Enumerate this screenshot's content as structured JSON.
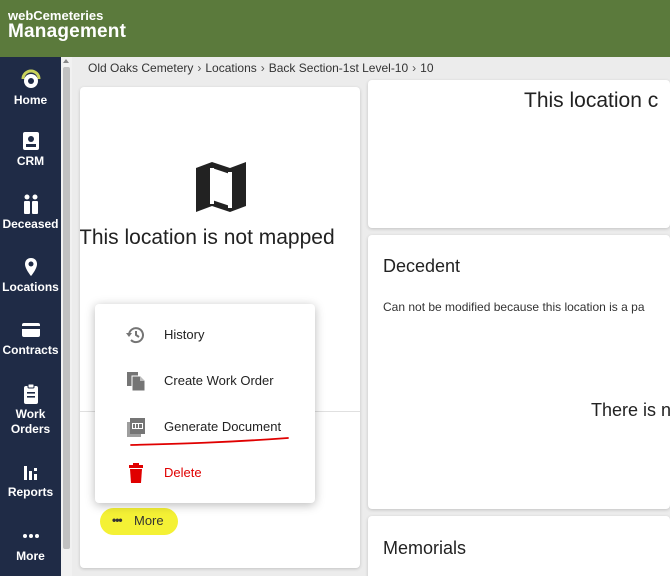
{
  "app": {
    "brand_small": "webCemeteries",
    "brand_big": "Management",
    "header_color": "#5b7a3c",
    "sidebar_color": "#1f2b46"
  },
  "sidebar": {
    "items": [
      {
        "label": "Home",
        "icon": "home-gauge-icon"
      },
      {
        "label": "CRM",
        "icon": "contact-card-icon"
      },
      {
        "label": "Deceased",
        "icon": "people-icon"
      },
      {
        "label": "Locations",
        "icon": "location-pin-icon"
      },
      {
        "label": "Contracts",
        "icon": "credit-card-icon"
      },
      {
        "label": "Work Orders",
        "icon": "clipboard-icon"
      },
      {
        "label": "Reports",
        "icon": "bar-chart-icon"
      },
      {
        "label": "More",
        "icon": "dots-icon"
      }
    ]
  },
  "breadcrumb": [
    "Old Oaks Cemetery",
    "Locations",
    "Back Section-1st Level-10",
    "10"
  ],
  "breadcrumb_separator": "›",
  "map_panel": {
    "message": "This location is not mapped",
    "icon": "map-icon"
  },
  "more_button": {
    "dots": "•••",
    "label": "More",
    "highlight_color": "#f4f135"
  },
  "menu": {
    "items": [
      {
        "label": "History",
        "icon": "history-icon"
      },
      {
        "label": "Create Work Order",
        "icon": "file-copy-icon"
      },
      {
        "label": "Generate Document",
        "icon": "pdf-icon"
      },
      {
        "label": "Delete",
        "icon": "trash-icon"
      }
    ],
    "delete_color": "#e00000",
    "annotation_color": "#e00000"
  },
  "right": {
    "top_title": "This location c",
    "decedent_heading": "Decedent",
    "decedent_message": "Can not be modified because this location is a pa",
    "decedent_empty": "There is n",
    "memorials_heading": "Memorials"
  }
}
